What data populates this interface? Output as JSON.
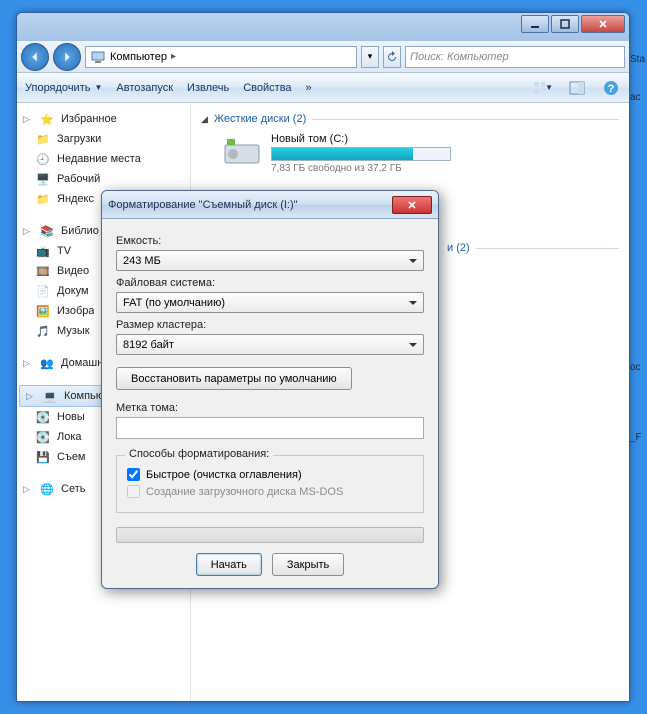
{
  "title": "",
  "breadcrumb": {
    "icon": "computer",
    "label": "Компьютер"
  },
  "search": {
    "placeholder": "Поиск: Компьютер"
  },
  "toolbar": {
    "organize": "Упорядочить",
    "autorun": "Автозапуск",
    "extract": "Извлечь",
    "properties": "Свойства",
    "more": "»"
  },
  "sidebar": {
    "favorites": {
      "label": "Избранное",
      "items": [
        {
          "label": "Загрузки",
          "icon": "folder"
        },
        {
          "label": "Недавние места",
          "icon": "recent"
        },
        {
          "label": "Рабочий",
          "icon": "desktop"
        },
        {
          "label": "Яндекс",
          "icon": "folder"
        }
      ]
    },
    "libraries": {
      "label": "Библио",
      "items": [
        {
          "label": "TV",
          "icon": "tv"
        },
        {
          "label": "Видео",
          "icon": "video"
        },
        {
          "label": "Докум",
          "icon": "doc"
        },
        {
          "label": "Изобра",
          "icon": "image"
        },
        {
          "label": "Музык",
          "icon": "music"
        }
      ]
    },
    "homegroup": {
      "label": "Домашн"
    },
    "computer": {
      "label": "Компью",
      "items": [
        {
          "label": "Новы",
          "icon": "drive"
        },
        {
          "label": "Лока",
          "icon": "drive2"
        },
        {
          "label": "Съем",
          "icon": "usb"
        }
      ]
    },
    "network": {
      "label": "Сеть"
    }
  },
  "main": {
    "hdd": {
      "header": "Жесткие диски (2)",
      "drive": {
        "name": "Новый том (C:)",
        "free": "7,83 ГБ свободно из 37,2 ГБ",
        "pct": 79
      }
    },
    "removable": {
      "header_tail": "и (2)"
    }
  },
  "dialog": {
    "title": "Форматирование \"Съемный диск (I:)\"",
    "capacity_label": "Емкость:",
    "capacity_value": "243 МБ",
    "fs_label": "Файловая система:",
    "fs_value": "FAT (по умолчанию)",
    "cluster_label": "Размер кластера:",
    "cluster_value": "8192 байт",
    "restore": "Восстановить параметры по умолчанию",
    "vol_label": "Метка тома:",
    "vol_value": "",
    "fmt_group": "Способы форматирования:",
    "quick": "Быстрое (очистка оглавления)",
    "msdos": "Создание загрузочного диска MS-DOS",
    "start": "Начать",
    "close": "Закрыть"
  },
  "desktop_fragments": {
    "a": "Sta",
    "b": "ас",
    "c": "ос",
    "d": "_F"
  }
}
